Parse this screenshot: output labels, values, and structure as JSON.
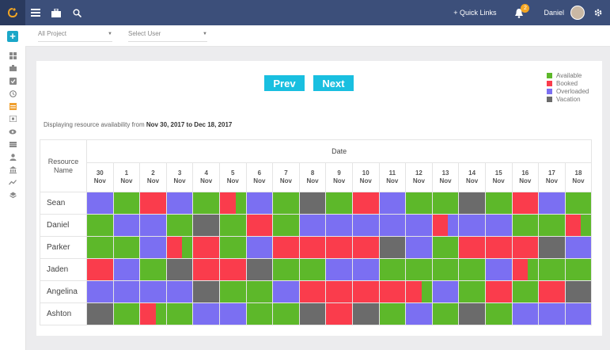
{
  "topbar": {
    "quick_links": "+ Quick Links",
    "notif_count": "2",
    "user": "Daniel"
  },
  "filters": {
    "project": "All Project",
    "user": "Select User"
  },
  "nav": {
    "prev": "Prev",
    "next": "Next"
  },
  "legend": [
    {
      "label": "Available",
      "color": "#5db82a"
    },
    {
      "label": "Booked",
      "color": "#fa3c4c"
    },
    {
      "label": "Overloaded",
      "color": "#7b6ff2"
    },
    {
      "label": "Vacation",
      "color": "#6b6b6b"
    }
  ],
  "note": {
    "prefix": "Displaying resource availability from ",
    "range": "Nov 30, 2017 to Dec 18, 2017"
  },
  "table": {
    "name_header_1": "Resource",
    "name_header_2": "Name",
    "date_header": "Date",
    "days": [
      {
        "d": "30",
        "m": "Nov"
      },
      {
        "d": "1",
        "m": "Nov"
      },
      {
        "d": "2",
        "m": "Nov"
      },
      {
        "d": "3",
        "m": "Nov"
      },
      {
        "d": "4",
        "m": "Nov"
      },
      {
        "d": "5",
        "m": "Nov"
      },
      {
        "d": "6",
        "m": "Nov"
      },
      {
        "d": "7",
        "m": "Nov"
      },
      {
        "d": "8",
        "m": "Nov"
      },
      {
        "d": "9",
        "m": "Nov"
      },
      {
        "d": "10",
        "m": "Nov"
      },
      {
        "d": "11",
        "m": "Nov"
      },
      {
        "d": "12",
        "m": "Nov"
      },
      {
        "d": "13",
        "m": "Nov"
      },
      {
        "d": "14",
        "m": "Nov"
      },
      {
        "d": "15",
        "m": "Nov"
      },
      {
        "d": "16",
        "m": "Nov"
      },
      {
        "d": "17",
        "m": "Nov"
      },
      {
        "d": "18",
        "m": "Nov"
      }
    ],
    "rows": [
      {
        "name": "Sean",
        "cells": [
          "O",
          "A",
          "B",
          "O",
          "A",
          "B|A",
          "O",
          "A",
          "V",
          "A",
          "B",
          "O",
          "A",
          "A",
          "V",
          "A",
          "B",
          "O",
          "A"
        ]
      },
      {
        "name": "Daniel",
        "cells": [
          "A",
          "O",
          "O",
          "A",
          "V",
          "A",
          "B",
          "A",
          "O",
          "O",
          "O",
          "O",
          "O",
          "B|O",
          "O",
          "O",
          "A",
          "A",
          "B|A"
        ]
      },
      {
        "name": "Parker",
        "cells": [
          "A",
          "A",
          "O",
          "B|A",
          "B",
          "A",
          "O",
          "B",
          "B",
          "B",
          "B",
          "V",
          "O",
          "A",
          "B",
          "B",
          "B",
          "V",
          "O"
        ]
      },
      {
        "name": "Jaden",
        "cells": [
          "B",
          "O",
          "A",
          "V",
          "B",
          "B",
          "V",
          "A",
          "A",
          "O",
          "O",
          "A",
          "A",
          "A",
          "A",
          "O",
          "B|A",
          "A",
          "A"
        ]
      },
      {
        "name": "Angelina",
        "cells": [
          "O",
          "O",
          "O",
          "O",
          "V",
          "A",
          "A",
          "O",
          "B",
          "B",
          "B",
          "B",
          "B|A",
          "O",
          "A",
          "B",
          "A",
          "B",
          "V"
        ]
      },
      {
        "name": "Ashton",
        "cells": [
          "V",
          "A",
          "B|A",
          "A",
          "O",
          "O",
          "A",
          "A",
          "V",
          "B",
          "V",
          "A",
          "O",
          "A",
          "V",
          "A",
          "O",
          "O",
          "O"
        ]
      }
    ]
  }
}
